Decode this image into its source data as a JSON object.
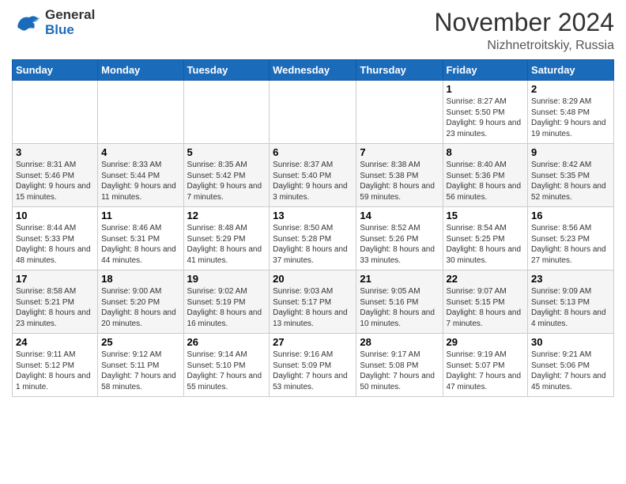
{
  "header": {
    "logo": {
      "general": "General",
      "blue": "Blue"
    },
    "title": "November 2024",
    "location": "Nizhnetroitskiy, Russia"
  },
  "weekdays": [
    "Sunday",
    "Monday",
    "Tuesday",
    "Wednesday",
    "Thursday",
    "Friday",
    "Saturday"
  ],
  "weeks": [
    [
      {
        "day": "",
        "info": ""
      },
      {
        "day": "",
        "info": ""
      },
      {
        "day": "",
        "info": ""
      },
      {
        "day": "",
        "info": ""
      },
      {
        "day": "",
        "info": ""
      },
      {
        "day": "1",
        "info": "Sunrise: 8:27 AM\nSunset: 5:50 PM\nDaylight: 9 hours and 23 minutes."
      },
      {
        "day": "2",
        "info": "Sunrise: 8:29 AM\nSunset: 5:48 PM\nDaylight: 9 hours and 19 minutes."
      }
    ],
    [
      {
        "day": "3",
        "info": "Sunrise: 8:31 AM\nSunset: 5:46 PM\nDaylight: 9 hours and 15 minutes."
      },
      {
        "day": "4",
        "info": "Sunrise: 8:33 AM\nSunset: 5:44 PM\nDaylight: 9 hours and 11 minutes."
      },
      {
        "day": "5",
        "info": "Sunrise: 8:35 AM\nSunset: 5:42 PM\nDaylight: 9 hours and 7 minutes."
      },
      {
        "day": "6",
        "info": "Sunrise: 8:37 AM\nSunset: 5:40 PM\nDaylight: 9 hours and 3 minutes."
      },
      {
        "day": "7",
        "info": "Sunrise: 8:38 AM\nSunset: 5:38 PM\nDaylight: 8 hours and 59 minutes."
      },
      {
        "day": "8",
        "info": "Sunrise: 8:40 AM\nSunset: 5:36 PM\nDaylight: 8 hours and 56 minutes."
      },
      {
        "day": "9",
        "info": "Sunrise: 8:42 AM\nSunset: 5:35 PM\nDaylight: 8 hours and 52 minutes."
      }
    ],
    [
      {
        "day": "10",
        "info": "Sunrise: 8:44 AM\nSunset: 5:33 PM\nDaylight: 8 hours and 48 minutes."
      },
      {
        "day": "11",
        "info": "Sunrise: 8:46 AM\nSunset: 5:31 PM\nDaylight: 8 hours and 44 minutes."
      },
      {
        "day": "12",
        "info": "Sunrise: 8:48 AM\nSunset: 5:29 PM\nDaylight: 8 hours and 41 minutes."
      },
      {
        "day": "13",
        "info": "Sunrise: 8:50 AM\nSunset: 5:28 PM\nDaylight: 8 hours and 37 minutes."
      },
      {
        "day": "14",
        "info": "Sunrise: 8:52 AM\nSunset: 5:26 PM\nDaylight: 8 hours and 33 minutes."
      },
      {
        "day": "15",
        "info": "Sunrise: 8:54 AM\nSunset: 5:25 PM\nDaylight: 8 hours and 30 minutes."
      },
      {
        "day": "16",
        "info": "Sunrise: 8:56 AM\nSunset: 5:23 PM\nDaylight: 8 hours and 27 minutes."
      }
    ],
    [
      {
        "day": "17",
        "info": "Sunrise: 8:58 AM\nSunset: 5:21 PM\nDaylight: 8 hours and 23 minutes."
      },
      {
        "day": "18",
        "info": "Sunrise: 9:00 AM\nSunset: 5:20 PM\nDaylight: 8 hours and 20 minutes."
      },
      {
        "day": "19",
        "info": "Sunrise: 9:02 AM\nSunset: 5:19 PM\nDaylight: 8 hours and 16 minutes."
      },
      {
        "day": "20",
        "info": "Sunrise: 9:03 AM\nSunset: 5:17 PM\nDaylight: 8 hours and 13 minutes."
      },
      {
        "day": "21",
        "info": "Sunrise: 9:05 AM\nSunset: 5:16 PM\nDaylight: 8 hours and 10 minutes."
      },
      {
        "day": "22",
        "info": "Sunrise: 9:07 AM\nSunset: 5:15 PM\nDaylight: 8 hours and 7 minutes."
      },
      {
        "day": "23",
        "info": "Sunrise: 9:09 AM\nSunset: 5:13 PM\nDaylight: 8 hours and 4 minutes."
      }
    ],
    [
      {
        "day": "24",
        "info": "Sunrise: 9:11 AM\nSunset: 5:12 PM\nDaylight: 8 hours and 1 minute."
      },
      {
        "day": "25",
        "info": "Sunrise: 9:12 AM\nSunset: 5:11 PM\nDaylight: 7 hours and 58 minutes."
      },
      {
        "day": "26",
        "info": "Sunrise: 9:14 AM\nSunset: 5:10 PM\nDaylight: 7 hours and 55 minutes."
      },
      {
        "day": "27",
        "info": "Sunrise: 9:16 AM\nSunset: 5:09 PM\nDaylight: 7 hours and 53 minutes."
      },
      {
        "day": "28",
        "info": "Sunrise: 9:17 AM\nSunset: 5:08 PM\nDaylight: 7 hours and 50 minutes."
      },
      {
        "day": "29",
        "info": "Sunrise: 9:19 AM\nSunset: 5:07 PM\nDaylight: 7 hours and 47 minutes."
      },
      {
        "day": "30",
        "info": "Sunrise: 9:21 AM\nSunset: 5:06 PM\nDaylight: 7 hours and 45 minutes."
      }
    ]
  ]
}
